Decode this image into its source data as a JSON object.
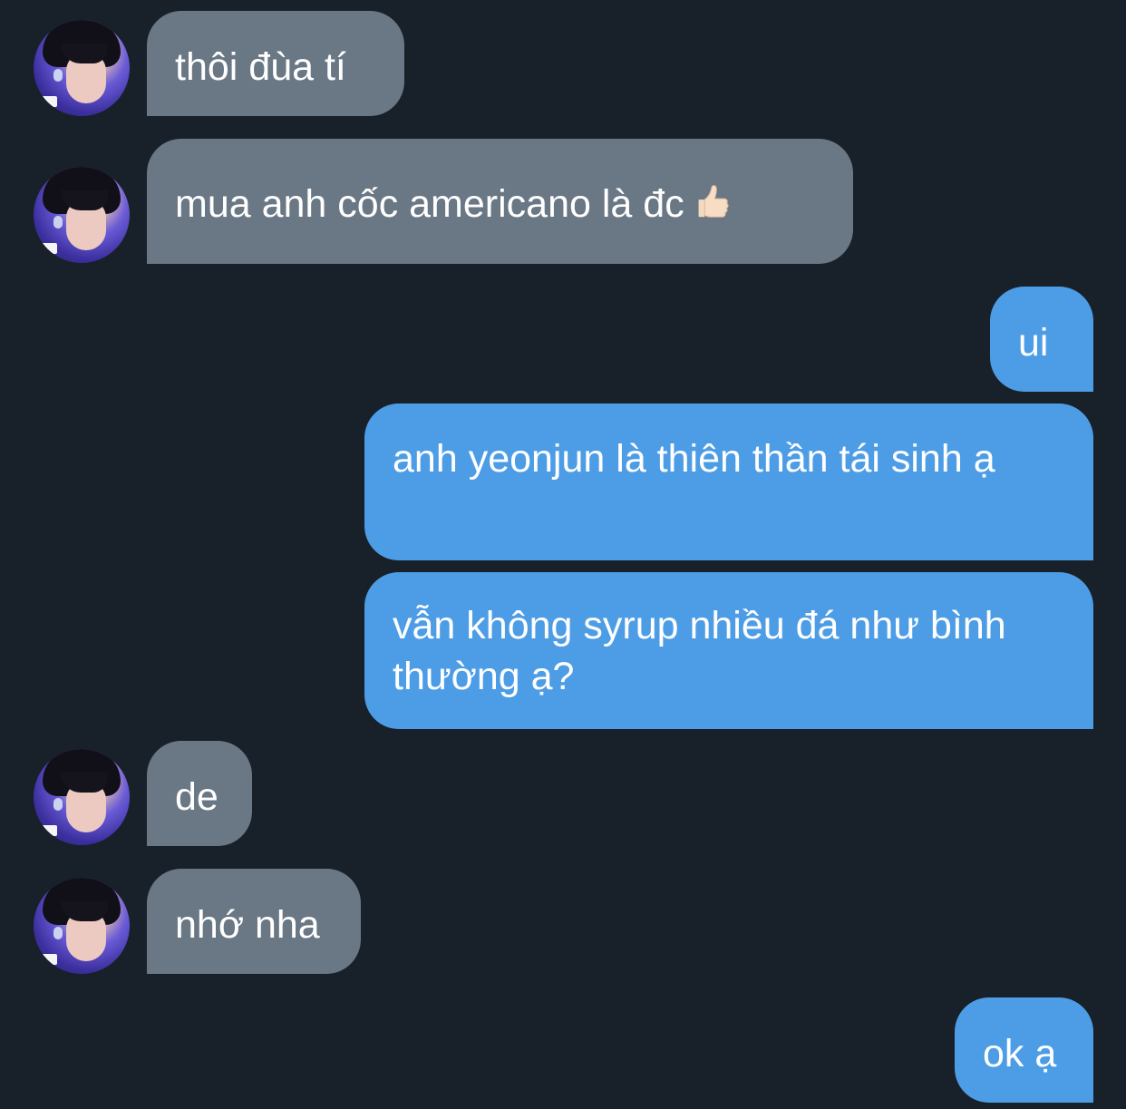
{
  "conversation": {
    "messages": [
      {
        "sender": "other",
        "text": "thôi đùa tí"
      },
      {
        "sender": "other",
        "text": "mua anh cốc americano là đc",
        "emoji": "thumbs-up-icon"
      },
      {
        "sender": "me",
        "text": "ui"
      },
      {
        "sender": "me",
        "text": "anh yeonjun là thiên thần tái sinh ạ"
      },
      {
        "sender": "me",
        "text": "vẫn không syrup nhiều đá như bình thường ạ?"
      },
      {
        "sender": "other",
        "text": "de"
      },
      {
        "sender": "other",
        "text": "nhớ nha"
      },
      {
        "sender": "me",
        "text": "ok ạ"
      }
    ]
  },
  "colors": {
    "background": "#18202a",
    "incoming_bubble": "#6a7785",
    "outgoing_bubble": "#4d9de6",
    "text": "#ffffff"
  }
}
